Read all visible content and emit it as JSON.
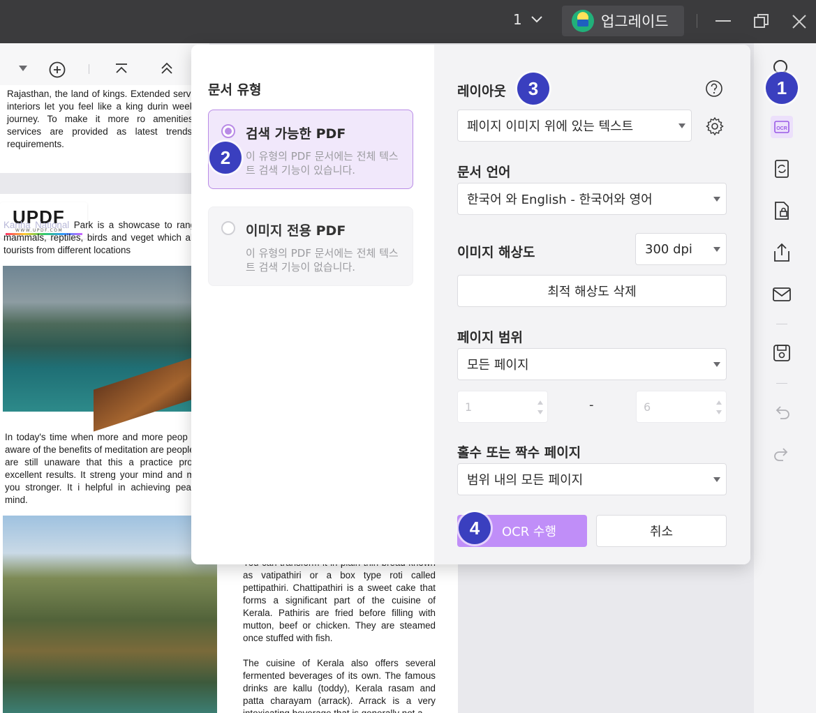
{
  "titlebar": {
    "page_number": "1",
    "upgrade_label": "업그레이드"
  },
  "document": {
    "para1": "Rajasthan, the land of kings. Extended servi royal interiors let you feel like a king durin week long journey. To make it more ro amenities and services are provided as latest trends and requirements.",
    "watermark": "UPDF",
    "watermark_url": "WWW.UPDF.COM",
    "para2_prefix": "Kanha National",
    "para2": " Park is a showcase to range of mammals, reptiles, birds and veget which allures tourists from different locations",
    "para3": "In today's time when more and more peop being aware of the benefits of meditation are people who are still unaware that this a practice provides excellent results. It streng your mind and makes you stronger. It i helpful in achieving peace of mind.",
    "para4": "You can transform it in plain thin bread known as vatipathiri or a box type roti called pettipathiri. Chattipathiri is a sweet cake that forms a significant part of the cuisine of Kerala. Pathiris are fried before filling with mutton, beef or chicken. They are steamed once stuffed with fish.",
    "para5": "The cuisine of Kerala also offers several fermented beverages of its own. The famous drinks are kallu (toddy), Kerala rasam and patta charayam (arrack). Arrack is a very intoxicating beverage that is generally not a"
  },
  "ocr_dialog": {
    "doc_type_heading": "문서 유형",
    "option_searchable": {
      "title": "검색 가능한 PDF",
      "desc": "이 유형의 PDF 문서에는 전체 텍스트 검색 기능이 있습니다."
    },
    "option_image_only": {
      "title": "이미지 전용 PDF",
      "desc": "이 유형의 PDF 문서에는 전체 텍스트 검색 기능이 없습니다."
    },
    "layout_heading": "레이아웃",
    "layout_value": "페이지 이미지 위에 있는 텍스트",
    "language_heading": "문서 언어",
    "language_value": "한국어 와 English - 한국어와 영어",
    "resolution_heading": "이미지 해상도",
    "resolution_value": "300 dpi",
    "detect_resolution_label": "최적 해상도 삭제",
    "page_range_heading": "페이지 범위",
    "page_range_value": "모든 페이지",
    "range_from": "1",
    "range_dash": "-",
    "range_to": "6",
    "odd_even_heading": "홀수 또는 짝수 페이지",
    "odd_even_value": "범위 내의 모든 페이지",
    "perform_ocr_label": "OCR 수행",
    "cancel_label": "취소"
  },
  "badges": [
    "1",
    "2",
    "3",
    "4"
  ],
  "colors": {
    "accent": "#c08ef8",
    "selected_border": "#b98be6",
    "badge": "#3a3fbf",
    "titlebar": "#3b3b3d"
  }
}
